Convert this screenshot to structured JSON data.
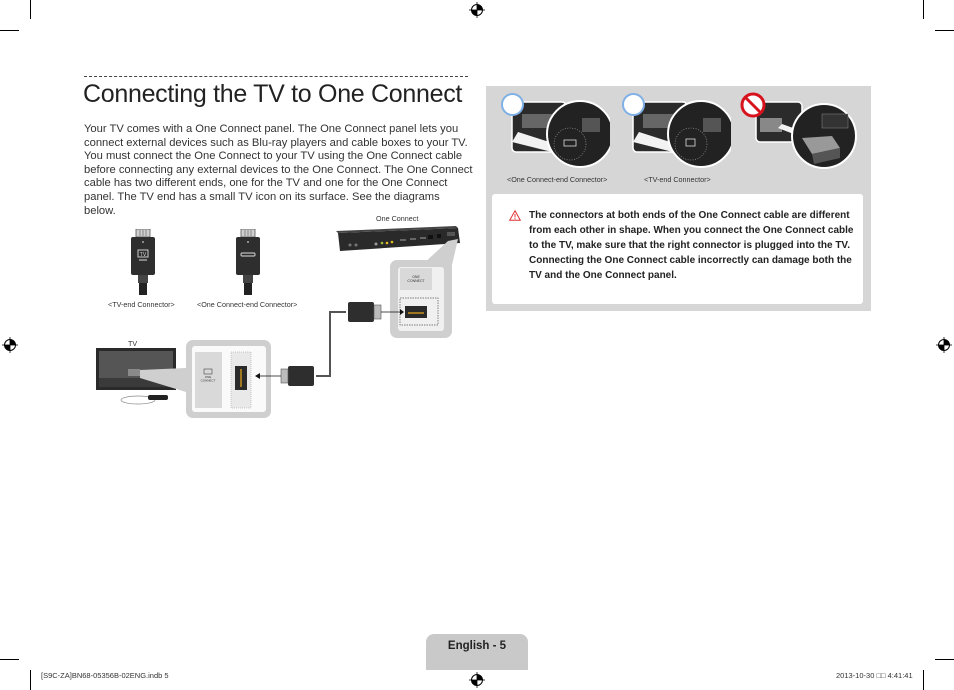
{
  "page": {
    "title": "Connecting the TV to One Connect",
    "intro": "Your TV comes with a One Connect panel. The One Connect panel lets you connect external devices such as Blu-ray players and cable boxes to your TV. You must connect the One Connect to your TV using the One Connect cable before connecting any external devices to the One Connect. The One Connect cable has two different ends, one for the TV and one for the One Connect panel. The TV end has a small TV icon on its surface. See the diagrams below."
  },
  "diagram": {
    "tv_end_label": "<TV-end Connector>",
    "oc_end_label": "<One Connect-end Connector>",
    "one_connect_label": "One Connect",
    "tv_label": "TV",
    "tv_icon_text": "TV",
    "port_label_line1": "ONE",
    "port_label_line2": "CONNECT"
  },
  "panel": {
    "images": [
      {
        "status": "correct",
        "caption": "<One Connect-end Connector>"
      },
      {
        "status": "correct",
        "caption": "<TV-end Connector>"
      },
      {
        "status": "prohibited",
        "caption": ""
      }
    ],
    "note_icon": "warning-triangle-icon",
    "note": "The connectors at both ends of the One Connect cable are different from each other in shape. When you connect the One Connect cable to the TV, make sure that the right connector is plugged into the TV. Connecting the One Connect cable incorrectly can damage both the TV and the One Connect panel."
  },
  "footer": {
    "page_label": "English - 5",
    "slug_file": "[S9C-ZA]BN68-05356B-02ENG.indb   5",
    "slug_date": "2013-10-30   □□ 4:41:41"
  },
  "colors": {
    "panel_bg": "#d6d6d6",
    "ok_ring": "#7fb0e6",
    "prohibit_red": "#d7141e",
    "warning_red": "#e03030",
    "footer_tab": "#c9c9c9"
  }
}
